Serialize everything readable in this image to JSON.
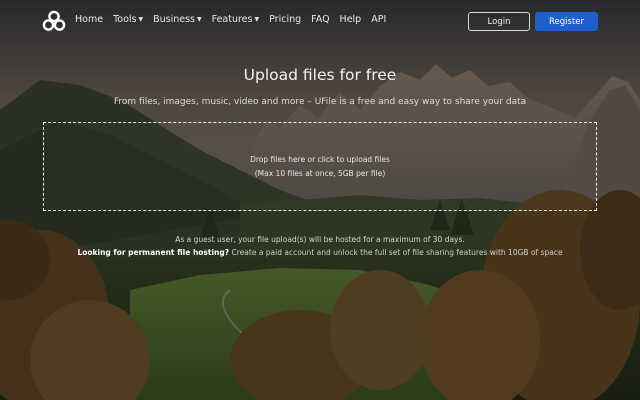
{
  "nav": {
    "logo_icon": "cloud-rings-logo-icon",
    "links": {
      "home": "Home",
      "tools": "Tools",
      "business": "Business",
      "features": "Features",
      "pricing": "Pricing",
      "faq": "FAQ",
      "help": "Help",
      "api": "API"
    },
    "login_label": "Login",
    "register_label": "Register"
  },
  "hero": {
    "title": "Upload files for free",
    "subtitle": "From files, images, music, video and more – UFile is a free and easy way to share your data"
  },
  "dropzone": {
    "line1": "Drop files here or click to upload files",
    "line2": "(Max 10 files at once, 5GB per file)"
  },
  "notes": {
    "guest": "As a guest user, your file upload(s) will be hosted for a maximum of 30 days.",
    "permanent_lead": "Looking for permanent file hosting?",
    "permanent_rest": " Create a paid account and unlock the full set of file sharing features with 10GB of space"
  },
  "colors": {
    "accent": "#1f5fcc",
    "text": "#f2f2f2"
  }
}
